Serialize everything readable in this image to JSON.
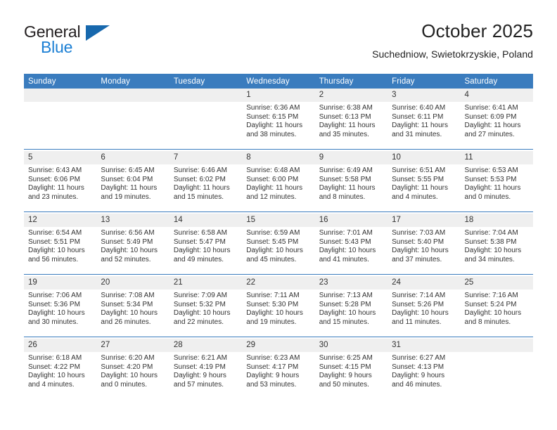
{
  "brand": {
    "name_line1": "General",
    "name_line2": "Blue",
    "triangle_color": "#1768ad",
    "blue_color": "#1b7fd4"
  },
  "header": {
    "title": "October 2025",
    "location": "Suchedniow, Swietokrzyskie, Poland"
  },
  "theme": {
    "header_bg": "#3a7cbe",
    "daynum_bg": "#efefef",
    "separator": "#3a7cbe"
  },
  "weekday_headers": [
    "Sunday",
    "Monday",
    "Tuesday",
    "Wednesday",
    "Thursday",
    "Friday",
    "Saturday"
  ],
  "weeks": [
    [
      {
        "day": "",
        "blank": true,
        "sunrise": "",
        "sunset": "",
        "daylight1": "",
        "daylight2": ""
      },
      {
        "day": "",
        "blank": true,
        "sunrise": "",
        "sunset": "",
        "daylight1": "",
        "daylight2": ""
      },
      {
        "day": "",
        "blank": true,
        "sunrise": "",
        "sunset": "",
        "daylight1": "",
        "daylight2": ""
      },
      {
        "day": "1",
        "blank": false,
        "sunrise": "Sunrise: 6:36 AM",
        "sunset": "Sunset: 6:15 PM",
        "daylight1": "Daylight: 11 hours",
        "daylight2": "and 38 minutes."
      },
      {
        "day": "2",
        "blank": false,
        "sunrise": "Sunrise: 6:38 AM",
        "sunset": "Sunset: 6:13 PM",
        "daylight1": "Daylight: 11 hours",
        "daylight2": "and 35 minutes."
      },
      {
        "day": "3",
        "blank": false,
        "sunrise": "Sunrise: 6:40 AM",
        "sunset": "Sunset: 6:11 PM",
        "daylight1": "Daylight: 11 hours",
        "daylight2": "and 31 minutes."
      },
      {
        "day": "4",
        "blank": false,
        "sunrise": "Sunrise: 6:41 AM",
        "sunset": "Sunset: 6:09 PM",
        "daylight1": "Daylight: 11 hours",
        "daylight2": "and 27 minutes."
      }
    ],
    [
      {
        "day": "5",
        "blank": false,
        "sunrise": "Sunrise: 6:43 AM",
        "sunset": "Sunset: 6:06 PM",
        "daylight1": "Daylight: 11 hours",
        "daylight2": "and 23 minutes."
      },
      {
        "day": "6",
        "blank": false,
        "sunrise": "Sunrise: 6:45 AM",
        "sunset": "Sunset: 6:04 PM",
        "daylight1": "Daylight: 11 hours",
        "daylight2": "and 19 minutes."
      },
      {
        "day": "7",
        "blank": false,
        "sunrise": "Sunrise: 6:46 AM",
        "sunset": "Sunset: 6:02 PM",
        "daylight1": "Daylight: 11 hours",
        "daylight2": "and 15 minutes."
      },
      {
        "day": "8",
        "blank": false,
        "sunrise": "Sunrise: 6:48 AM",
        "sunset": "Sunset: 6:00 PM",
        "daylight1": "Daylight: 11 hours",
        "daylight2": "and 12 minutes."
      },
      {
        "day": "9",
        "blank": false,
        "sunrise": "Sunrise: 6:49 AM",
        "sunset": "Sunset: 5:58 PM",
        "daylight1": "Daylight: 11 hours",
        "daylight2": "and 8 minutes."
      },
      {
        "day": "10",
        "blank": false,
        "sunrise": "Sunrise: 6:51 AM",
        "sunset": "Sunset: 5:55 PM",
        "daylight1": "Daylight: 11 hours",
        "daylight2": "and 4 minutes."
      },
      {
        "day": "11",
        "blank": false,
        "sunrise": "Sunrise: 6:53 AM",
        "sunset": "Sunset: 5:53 PM",
        "daylight1": "Daylight: 11 hours",
        "daylight2": "and 0 minutes."
      }
    ],
    [
      {
        "day": "12",
        "blank": false,
        "sunrise": "Sunrise: 6:54 AM",
        "sunset": "Sunset: 5:51 PM",
        "daylight1": "Daylight: 10 hours",
        "daylight2": "and 56 minutes."
      },
      {
        "day": "13",
        "blank": false,
        "sunrise": "Sunrise: 6:56 AM",
        "sunset": "Sunset: 5:49 PM",
        "daylight1": "Daylight: 10 hours",
        "daylight2": "and 52 minutes."
      },
      {
        "day": "14",
        "blank": false,
        "sunrise": "Sunrise: 6:58 AM",
        "sunset": "Sunset: 5:47 PM",
        "daylight1": "Daylight: 10 hours",
        "daylight2": "and 49 minutes."
      },
      {
        "day": "15",
        "blank": false,
        "sunrise": "Sunrise: 6:59 AM",
        "sunset": "Sunset: 5:45 PM",
        "daylight1": "Daylight: 10 hours",
        "daylight2": "and 45 minutes."
      },
      {
        "day": "16",
        "blank": false,
        "sunrise": "Sunrise: 7:01 AM",
        "sunset": "Sunset: 5:43 PM",
        "daylight1": "Daylight: 10 hours",
        "daylight2": "and 41 minutes."
      },
      {
        "day": "17",
        "blank": false,
        "sunrise": "Sunrise: 7:03 AM",
        "sunset": "Sunset: 5:40 PM",
        "daylight1": "Daylight: 10 hours",
        "daylight2": "and 37 minutes."
      },
      {
        "day": "18",
        "blank": false,
        "sunrise": "Sunrise: 7:04 AM",
        "sunset": "Sunset: 5:38 PM",
        "daylight1": "Daylight: 10 hours",
        "daylight2": "and 34 minutes."
      }
    ],
    [
      {
        "day": "19",
        "blank": false,
        "sunrise": "Sunrise: 7:06 AM",
        "sunset": "Sunset: 5:36 PM",
        "daylight1": "Daylight: 10 hours",
        "daylight2": "and 30 minutes."
      },
      {
        "day": "20",
        "blank": false,
        "sunrise": "Sunrise: 7:08 AM",
        "sunset": "Sunset: 5:34 PM",
        "daylight1": "Daylight: 10 hours",
        "daylight2": "and 26 minutes."
      },
      {
        "day": "21",
        "blank": false,
        "sunrise": "Sunrise: 7:09 AM",
        "sunset": "Sunset: 5:32 PM",
        "daylight1": "Daylight: 10 hours",
        "daylight2": "and 22 minutes."
      },
      {
        "day": "22",
        "blank": false,
        "sunrise": "Sunrise: 7:11 AM",
        "sunset": "Sunset: 5:30 PM",
        "daylight1": "Daylight: 10 hours",
        "daylight2": "and 19 minutes."
      },
      {
        "day": "23",
        "blank": false,
        "sunrise": "Sunrise: 7:13 AM",
        "sunset": "Sunset: 5:28 PM",
        "daylight1": "Daylight: 10 hours",
        "daylight2": "and 15 minutes."
      },
      {
        "day": "24",
        "blank": false,
        "sunrise": "Sunrise: 7:14 AM",
        "sunset": "Sunset: 5:26 PM",
        "daylight1": "Daylight: 10 hours",
        "daylight2": "and 11 minutes."
      },
      {
        "day": "25",
        "blank": false,
        "sunrise": "Sunrise: 7:16 AM",
        "sunset": "Sunset: 5:24 PM",
        "daylight1": "Daylight: 10 hours",
        "daylight2": "and 8 minutes."
      }
    ],
    [
      {
        "day": "26",
        "blank": false,
        "sunrise": "Sunrise: 6:18 AM",
        "sunset": "Sunset: 4:22 PM",
        "daylight1": "Daylight: 10 hours",
        "daylight2": "and 4 minutes."
      },
      {
        "day": "27",
        "blank": false,
        "sunrise": "Sunrise: 6:20 AM",
        "sunset": "Sunset: 4:20 PM",
        "daylight1": "Daylight: 10 hours",
        "daylight2": "and 0 minutes."
      },
      {
        "day": "28",
        "blank": false,
        "sunrise": "Sunrise: 6:21 AM",
        "sunset": "Sunset: 4:19 PM",
        "daylight1": "Daylight: 9 hours",
        "daylight2": "and 57 minutes."
      },
      {
        "day": "29",
        "blank": false,
        "sunrise": "Sunrise: 6:23 AM",
        "sunset": "Sunset: 4:17 PM",
        "daylight1": "Daylight: 9 hours",
        "daylight2": "and 53 minutes."
      },
      {
        "day": "30",
        "blank": false,
        "sunrise": "Sunrise: 6:25 AM",
        "sunset": "Sunset: 4:15 PM",
        "daylight1": "Daylight: 9 hours",
        "daylight2": "and 50 minutes."
      },
      {
        "day": "31",
        "blank": false,
        "sunrise": "Sunrise: 6:27 AM",
        "sunset": "Sunset: 4:13 PM",
        "daylight1": "Daylight: 9 hours",
        "daylight2": "and 46 minutes."
      },
      {
        "day": "",
        "blank": true,
        "sunrise": "",
        "sunset": "",
        "daylight1": "",
        "daylight2": ""
      }
    ]
  ]
}
